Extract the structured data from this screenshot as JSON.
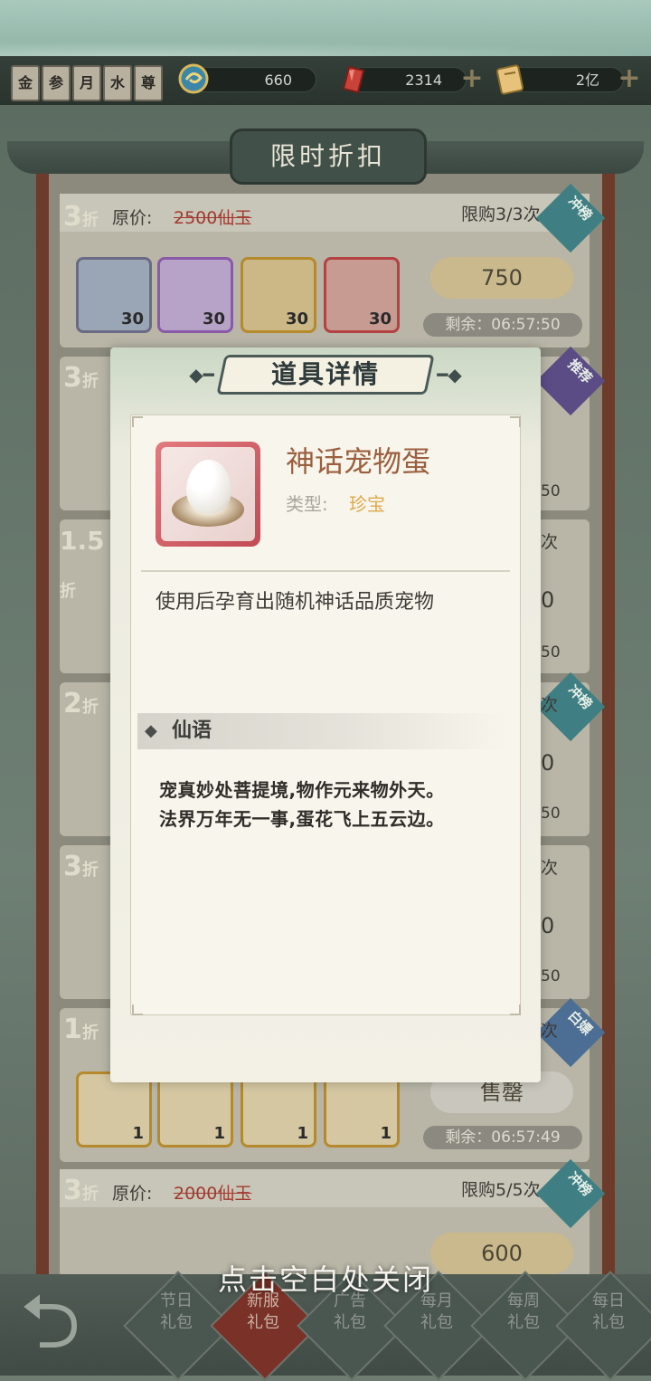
{
  "topbar": {
    "rank_badges": [
      "金",
      "参",
      "月",
      "水",
      "尊"
    ],
    "resources": [
      {
        "icon": "swirl-coin-icon",
        "value": "660"
      },
      {
        "icon": "red-jade-icon",
        "value": "2314"
      },
      {
        "icon": "scroll-ticket-icon",
        "value": "2亿"
      }
    ],
    "plus_symbol": "+"
  },
  "screen_title": "限时折扣",
  "deals": [
    {
      "discount": "3",
      "unit": "折",
      "price_label": "原价:",
      "original_price": "2500仙玉",
      "limit": "限购3/3次",
      "tag": "冲榜",
      "tag_color": "#3f7f83",
      "items": [
        {
          "count": "30"
        },
        {
          "count": "30"
        },
        {
          "count": "30"
        },
        {
          "count": "30"
        }
      ],
      "buy_price": "750",
      "timer": "剩余：06:57:50"
    },
    {
      "discount": "3",
      "unit": "折",
      "tag": "推荐",
      "tag_color": "#5b4c86",
      "timer": "50"
    },
    {
      "discount": "1.5",
      "unit": "折",
      "limit": "次",
      "buy_price": "0",
      "timer": "50"
    },
    {
      "discount": "2",
      "unit": "折",
      "tag": "冲榜",
      "tag_color": "#3f7f83",
      "limit": "次",
      "buy_price": "0",
      "timer": "50"
    },
    {
      "discount": "3",
      "unit": "折",
      "limit": "次",
      "buy_price": "0",
      "timer": "50"
    },
    {
      "discount": "1",
      "unit": "折",
      "tag": "白嫖",
      "tag_color": "#4c6e94",
      "limit": "次",
      "items": [
        {
          "count": "1"
        },
        {
          "count": "1"
        },
        {
          "count": "1"
        },
        {
          "count": "1"
        }
      ],
      "buy_price": "售罄",
      "timer": "剩余：06:57:49"
    },
    {
      "discount": "3",
      "unit": "折",
      "price_label": "原价:",
      "original_price": "2000仙玉",
      "limit": "限购5/5次",
      "tag": "冲榜",
      "tag_color": "#3f7f83",
      "buy_price": "600"
    }
  ],
  "bottom_nav": [
    {
      "line1": "节日",
      "line2": "礼包"
    },
    {
      "line1": "新服",
      "line2": "礼包",
      "active": true
    },
    {
      "line1": "广告",
      "line2": "礼包"
    },
    {
      "line1": "每月",
      "line2": "礼包"
    },
    {
      "line1": "每周",
      "line2": "礼包"
    },
    {
      "line1": "每日",
      "line2": "礼包"
    }
  ],
  "modal": {
    "title": "道具详情",
    "item": {
      "name": "神话宠物蛋",
      "type_label": "类型:",
      "type_value": "珍宝",
      "icon": "pet-egg-icon",
      "description": "使用后孕育出随机神话品质宠物"
    },
    "lore_title": "仙语",
    "lore_lines": [
      "宠真妙处菩提境,物作元来物外天。",
      "法界万年无一事,蛋花飞上五云边。"
    ]
  },
  "close_hint": "点击空白处关闭"
}
